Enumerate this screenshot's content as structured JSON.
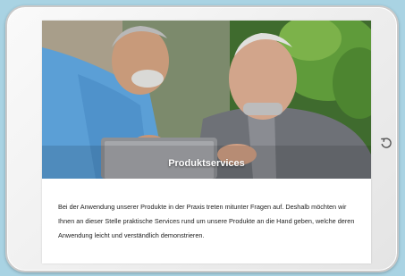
{
  "hero": {
    "title": "Produktservices"
  },
  "content": {
    "description": "Bei der Anwendung unserer Produkte in der Praxis treten mitunter Fragen auf. Deshalb möchten wir Ihnen an dieser Stelle praktische Services rund um unsere Produkte an die Hand geben, welche deren Anwendung leicht und verständlich demonstrieren."
  },
  "device": {
    "home_icon": "rotate-icon"
  },
  "colors": {
    "background": "#a9d3e3",
    "scrub_blue": "#5b9fd6",
    "sweater_gray": "#6e7177"
  }
}
